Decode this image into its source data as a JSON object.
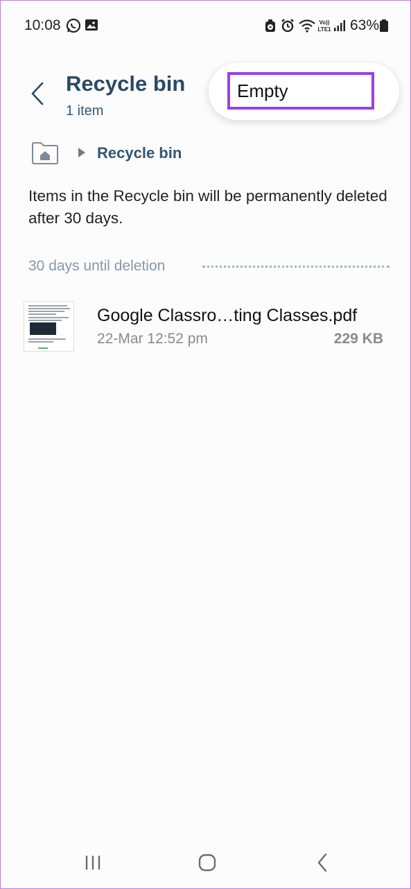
{
  "status_bar": {
    "time": "10:08",
    "battery": "63%",
    "icons": [
      "whatsapp-icon",
      "gallery-icon",
      "dnd-icon",
      "alarm-icon",
      "wifi-icon",
      "volte-lte-icon",
      "signal-icon",
      "battery-icon"
    ]
  },
  "header": {
    "title": "Recycle bin",
    "subtitle": "1 item"
  },
  "menu": {
    "items": [
      "Empty"
    ]
  },
  "breadcrumb": {
    "current": "Recycle bin"
  },
  "info": {
    "text": "Items in the Recycle bin will be permanently deleted after 30 days."
  },
  "section": {
    "label": "30 days until deletion"
  },
  "files": [
    {
      "name": "Google Classro…ting Classes.pdf",
      "date": "22-Mar 12:52 pm",
      "size": "229 KB"
    }
  ],
  "colors": {
    "accent_title": "#2a4a66",
    "highlight_border": "#9b3fe8",
    "section_label": "#8797a6"
  },
  "navigation": {
    "buttons": [
      "recents-button",
      "home-button",
      "back-button"
    ]
  }
}
